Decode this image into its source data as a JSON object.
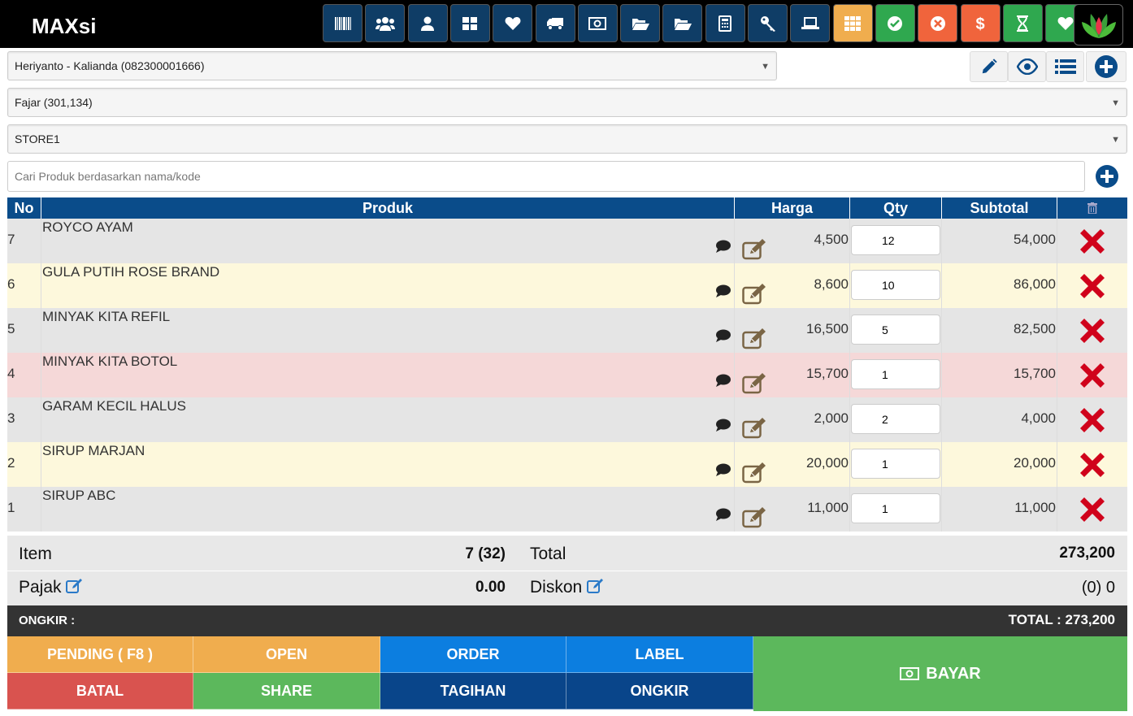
{
  "app": {
    "title": "MAXsi"
  },
  "toolbar": {
    "buttons": [
      {
        "icon": "barcode-icon",
        "color": "#0f3d66"
      },
      {
        "icon": "users-icon",
        "color": "#0f3d66"
      },
      {
        "icon": "user-icon",
        "color": "#0f3d66"
      },
      {
        "icon": "grid-icon",
        "color": "#0f3d66"
      },
      {
        "icon": "heart-icon",
        "color": "#0f3d66"
      },
      {
        "icon": "truck-icon",
        "color": "#0f3d66"
      },
      {
        "icon": "money-icon",
        "color": "#0f3d66"
      },
      {
        "icon": "folder-open-icon",
        "color": "#0f3d66"
      },
      {
        "icon": "folder-open-icon",
        "color": "#0f3d66"
      },
      {
        "icon": "calculator-icon",
        "color": "#0f3d66"
      },
      {
        "icon": "key-icon",
        "color": "#0f3d66"
      },
      {
        "icon": "laptop-icon",
        "color": "#0f3d66"
      },
      {
        "icon": "apps-grid-icon",
        "color": "#f0ad4e"
      },
      {
        "icon": "check-circle-icon",
        "color": "#2fa84f"
      },
      {
        "icon": "x-circle-icon",
        "color": "#f0643c"
      },
      {
        "icon": "dollar-icon",
        "color": "#f0643c"
      },
      {
        "icon": "hourglass-icon",
        "color": "#2fa84f"
      },
      {
        "icon": "heart-icon",
        "color": "#2fa84f"
      }
    ],
    "logo_icon": "lotus-logo-icon"
  },
  "customer": {
    "value": "Heriyanto - Kalianda (082300001666)"
  },
  "salesman": {
    "value": "Fajar (301,134)"
  },
  "store": {
    "value": "STORE1"
  },
  "actions": {
    "icons": [
      "pencil-icon",
      "eye-icon",
      "list-icon",
      "plus-circle-icon"
    ]
  },
  "search": {
    "placeholder": "Cari Produk berdasarkan nama/kode"
  },
  "table": {
    "headers": {
      "no": "No",
      "produk": "Produk",
      "harga": "Harga",
      "qty": "Qty",
      "subtotal": "Subtotal",
      "delete_icon": "trash-icon"
    },
    "rows": [
      {
        "no": "7",
        "produk": "ROYCO AYAM",
        "harga": "4,500",
        "qty": "12",
        "subtotal": "54,000",
        "bg": "#e5e5e5"
      },
      {
        "no": "6",
        "produk": "GULA PUTIH ROSE BRAND",
        "harga": "8,600",
        "qty": "10",
        "subtotal": "86,000",
        "bg": "#fdf8dc"
      },
      {
        "no": "5",
        "produk": "MINYAK KITA REFIL",
        "harga": "16,500",
        "qty": "5",
        "subtotal": "82,500",
        "bg": "#e5e5e5"
      },
      {
        "no": "4",
        "produk": "MINYAK KITA BOTOL",
        "harga": "15,700",
        "qty": "1",
        "subtotal": "15,700",
        "bg": "#f5d8d8"
      },
      {
        "no": "3",
        "produk": "GARAM KECIL HALUS",
        "harga": "2,000",
        "qty": "2",
        "subtotal": "4,000",
        "bg": "#e5e5e5"
      },
      {
        "no": "2",
        "produk": "SIRUP MARJAN",
        "harga": "20,000",
        "qty": "1",
        "subtotal": "20,000",
        "bg": "#fdf8dc"
      },
      {
        "no": "1",
        "produk": "SIRUP ABC",
        "harga": "11,000",
        "qty": "1",
        "subtotal": "11,000",
        "bg": "#e5e5e5"
      }
    ]
  },
  "summary": {
    "item_label": "Item",
    "item_value": "7 (32)",
    "total_label": "Total",
    "total_value": "273,200",
    "pajak_label": "Pajak",
    "pajak_value": "0.00",
    "diskon_label": "Diskon",
    "diskon_value": "(0) 0"
  },
  "ongkir_bar": {
    "label": "ONGKIR :",
    "total": "TOTAL : 273,200"
  },
  "buttons": {
    "pending": "PENDING ( F8 )",
    "open": "OPEN",
    "order": "ORDER",
    "label": "LABEL",
    "batal": "BATAL",
    "share": "SHARE",
    "tagihan": "TAGIHAN",
    "ongkir": "ONGKIR",
    "bayar": "BAYAR"
  },
  "colors": {
    "header_blue": "#0a4c8a",
    "orange": "#f0ad4e",
    "green": "#5cb85c",
    "red": "#d9534f",
    "blue": "#0c7ee0",
    "dark_blue": "#09458a",
    "delete_red": "#d0021b"
  }
}
